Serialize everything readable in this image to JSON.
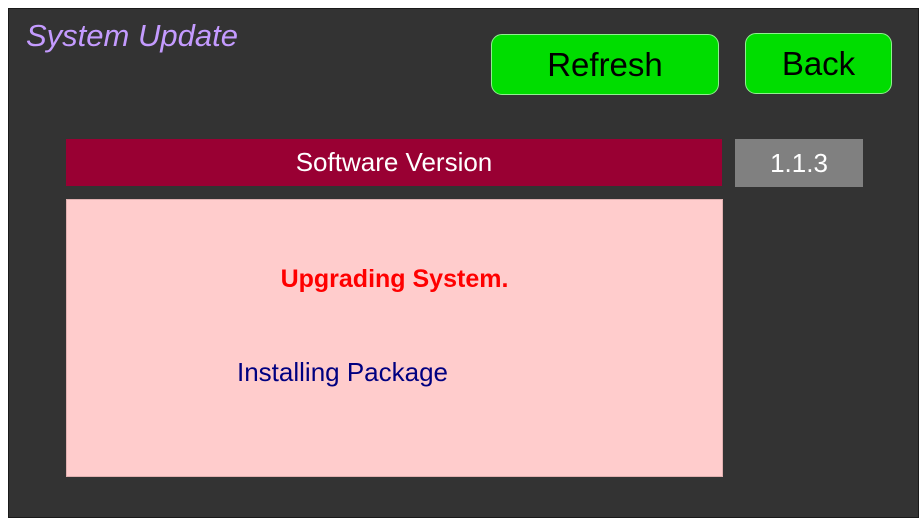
{
  "header": {
    "title": "System Update"
  },
  "toolbar": {
    "refresh_label": "Refresh",
    "back_label": "Back"
  },
  "software": {
    "label": "Software Version",
    "version": "1.1.3"
  },
  "status": {
    "title": "Upgrading System.",
    "detail": "Installing Package"
  },
  "colors": {
    "background": "#333333",
    "title": "#c49bff",
    "button": "#00dd00",
    "version_bar": "#990033",
    "version_value_bg": "#808080",
    "status_panel": "#ffcccc",
    "status_title": "#ff0000",
    "status_detail": "#000080"
  }
}
